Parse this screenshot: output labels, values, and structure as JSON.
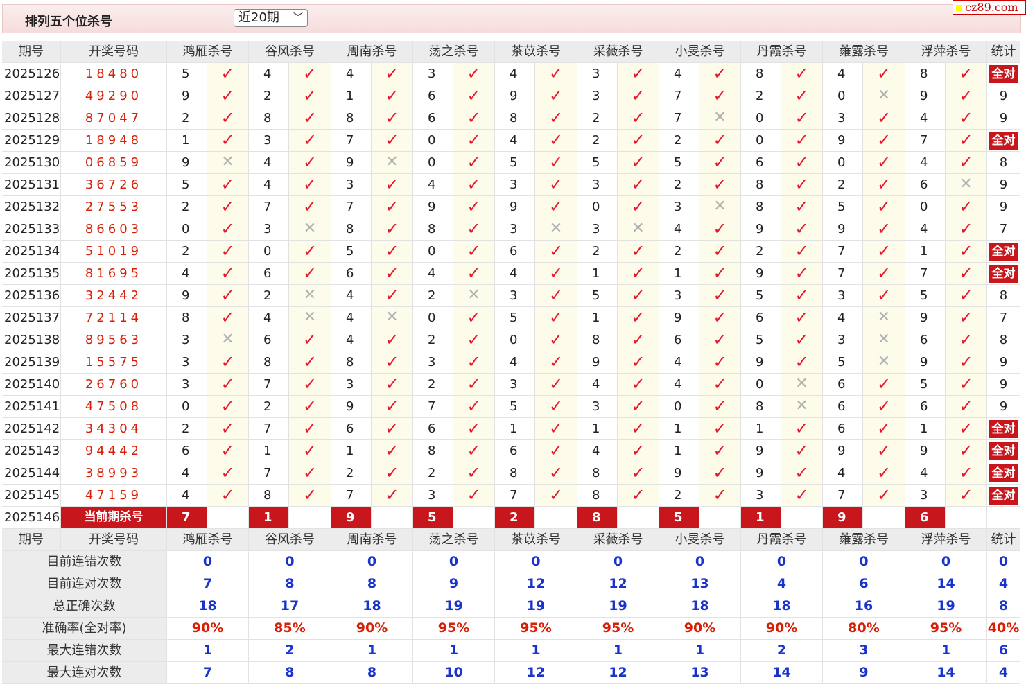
{
  "page_title": "排列五个位杀号",
  "period_select": {
    "value": "近20期"
  },
  "site_badge": "cz89.com",
  "columns": {
    "period": "期号",
    "draw": "开奖号码",
    "experts": [
      "鸿雁杀号",
      "谷风杀号",
      "周南杀号",
      "荡之杀号",
      "茶苡杀号",
      "采薇杀号",
      "小旻杀号",
      "丹霞杀号",
      "蕹露杀号",
      "浮萍杀号"
    ],
    "stat": "统计"
  },
  "rows": [
    {
      "period": "2025126",
      "draw": "18480",
      "kills": [
        5,
        4,
        4,
        3,
        4,
        3,
        4,
        8,
        4,
        8
      ],
      "results": [
        1,
        1,
        1,
        1,
        1,
        1,
        1,
        1,
        1,
        1
      ],
      "stat": "全对"
    },
    {
      "period": "2025127",
      "draw": "49290",
      "kills": [
        9,
        2,
        1,
        6,
        9,
        3,
        7,
        2,
        0,
        9
      ],
      "results": [
        1,
        1,
        1,
        1,
        1,
        1,
        1,
        1,
        0,
        1
      ],
      "stat": "9"
    },
    {
      "period": "2025128",
      "draw": "87047",
      "kills": [
        2,
        8,
        8,
        6,
        8,
        2,
        7,
        0,
        3,
        4
      ],
      "results": [
        1,
        1,
        1,
        1,
        1,
        1,
        0,
        1,
        1,
        1
      ],
      "stat": "9"
    },
    {
      "period": "2025129",
      "draw": "18948",
      "kills": [
        1,
        3,
        7,
        0,
        4,
        2,
        2,
        0,
        9,
        7
      ],
      "results": [
        1,
        1,
        1,
        1,
        1,
        1,
        1,
        1,
        1,
        1
      ],
      "stat": "全对"
    },
    {
      "period": "2025130",
      "draw": "06859",
      "kills": [
        9,
        4,
        9,
        0,
        5,
        5,
        5,
        6,
        0,
        4
      ],
      "results": [
        0,
        1,
        0,
        1,
        1,
        1,
        1,
        1,
        1,
        1
      ],
      "stat": "8"
    },
    {
      "period": "2025131",
      "draw": "36726",
      "kills": [
        5,
        4,
        3,
        4,
        3,
        3,
        2,
        8,
        2,
        6
      ],
      "results": [
        1,
        1,
        1,
        1,
        1,
        1,
        1,
        1,
        1,
        0
      ],
      "stat": "9"
    },
    {
      "period": "2025132",
      "draw": "27553",
      "kills": [
        2,
        7,
        7,
        9,
        9,
        0,
        3,
        8,
        5,
        0
      ],
      "results": [
        1,
        1,
        1,
        1,
        1,
        1,
        0,
        1,
        1,
        1
      ],
      "stat": "9"
    },
    {
      "period": "2025133",
      "draw": "86603",
      "kills": [
        0,
        3,
        8,
        8,
        3,
        3,
        4,
        9,
        9,
        4
      ],
      "results": [
        1,
        0,
        1,
        1,
        0,
        0,
        1,
        1,
        1,
        1
      ],
      "stat": "7"
    },
    {
      "period": "2025134",
      "draw": "51019",
      "kills": [
        2,
        0,
        5,
        0,
        6,
        2,
        2,
        2,
        7,
        1
      ],
      "results": [
        1,
        1,
        1,
        1,
        1,
        1,
        1,
        1,
        1,
        1
      ],
      "stat": "全对"
    },
    {
      "period": "2025135",
      "draw": "81695",
      "kills": [
        4,
        6,
        6,
        4,
        4,
        1,
        1,
        9,
        7,
        7
      ],
      "results": [
        1,
        1,
        1,
        1,
        1,
        1,
        1,
        1,
        1,
        1
      ],
      "stat": "全对"
    },
    {
      "period": "2025136",
      "draw": "32442",
      "kills": [
        9,
        2,
        4,
        2,
        3,
        5,
        3,
        5,
        3,
        5
      ],
      "results": [
        1,
        0,
        1,
        0,
        1,
        1,
        1,
        1,
        1,
        1
      ],
      "stat": "8"
    },
    {
      "period": "2025137",
      "draw": "72114",
      "kills": [
        8,
        4,
        4,
        0,
        5,
        1,
        9,
        6,
        4,
        9
      ],
      "results": [
        1,
        0,
        0,
        1,
        1,
        1,
        1,
        1,
        0,
        1
      ],
      "stat": "7"
    },
    {
      "period": "2025138",
      "draw": "89563",
      "kills": [
        3,
        6,
        4,
        2,
        0,
        8,
        6,
        5,
        3,
        6
      ],
      "results": [
        0,
        1,
        1,
        1,
        1,
        1,
        1,
        1,
        0,
        1
      ],
      "stat": "8"
    },
    {
      "period": "2025139",
      "draw": "15575",
      "kills": [
        3,
        8,
        8,
        3,
        4,
        9,
        4,
        9,
        5,
        9
      ],
      "results": [
        1,
        1,
        1,
        1,
        1,
        1,
        1,
        1,
        0,
        1
      ],
      "stat": "9"
    },
    {
      "period": "2025140",
      "draw": "26760",
      "kills": [
        3,
        7,
        3,
        2,
        3,
        4,
        4,
        0,
        6,
        5
      ],
      "results": [
        1,
        1,
        1,
        1,
        1,
        1,
        1,
        0,
        1,
        1
      ],
      "stat": "9"
    },
    {
      "period": "2025141",
      "draw": "47508",
      "kills": [
        0,
        2,
        9,
        7,
        5,
        3,
        0,
        8,
        6,
        6
      ],
      "results": [
        1,
        1,
        1,
        1,
        1,
        1,
        1,
        0,
        1,
        1
      ],
      "stat": "9"
    },
    {
      "period": "2025142",
      "draw": "34304",
      "kills": [
        2,
        7,
        6,
        6,
        1,
        1,
        1,
        1,
        6,
        1
      ],
      "results": [
        1,
        1,
        1,
        1,
        1,
        1,
        1,
        1,
        1,
        1
      ],
      "stat": "全对"
    },
    {
      "period": "2025143",
      "draw": "94442",
      "kills": [
        6,
        1,
        1,
        8,
        6,
        4,
        1,
        9,
        9,
        9
      ],
      "results": [
        1,
        1,
        1,
        1,
        1,
        1,
        1,
        1,
        1,
        1
      ],
      "stat": "全对"
    },
    {
      "period": "2025144",
      "draw": "38993",
      "kills": [
        4,
        7,
        2,
        2,
        8,
        8,
        9,
        9,
        4,
        4
      ],
      "results": [
        1,
        1,
        1,
        1,
        1,
        1,
        1,
        1,
        1,
        1
      ],
      "stat": "全对"
    },
    {
      "period": "2025145",
      "draw": "47159",
      "kills": [
        4,
        8,
        7,
        3,
        7,
        8,
        2,
        3,
        7,
        3
      ],
      "results": [
        1,
        1,
        1,
        1,
        1,
        1,
        1,
        1,
        1,
        1
      ],
      "stat": "全对"
    }
  ],
  "current": {
    "period": "2025146",
    "label": "当前期杀号",
    "kills": [
      7,
      1,
      9,
      5,
      2,
      8,
      5,
      1,
      9,
      6
    ]
  },
  "summary": [
    {
      "label": "目前连错次数",
      "values": [
        "0",
        "0",
        "0",
        "0",
        "0",
        "0",
        "0",
        "0",
        "0",
        "0",
        "0"
      ],
      "kind": "num"
    },
    {
      "label": "目前连对次数",
      "values": [
        "7",
        "8",
        "8",
        "9",
        "12",
        "12",
        "13",
        "4",
        "6",
        "14",
        "4"
      ],
      "kind": "num"
    },
    {
      "label": "总正确次数",
      "values": [
        "18",
        "17",
        "18",
        "19",
        "19",
        "19",
        "18",
        "18",
        "16",
        "19",
        "8"
      ],
      "kind": "num"
    },
    {
      "label": "准确率(全对率)",
      "values": [
        "90%",
        "85%",
        "90%",
        "95%",
        "95%",
        "95%",
        "90%",
        "90%",
        "80%",
        "95%",
        "40%"
      ],
      "kind": "pct"
    },
    {
      "label": "最大连错次数",
      "values": [
        "1",
        "2",
        "1",
        "1",
        "1",
        "1",
        "1",
        "2",
        "3",
        "1",
        "6"
      ],
      "kind": "num"
    },
    {
      "label": "最大连对次数",
      "values": [
        "7",
        "8",
        "8",
        "10",
        "12",
        "12",
        "13",
        "14",
        "9",
        "14",
        "4"
      ],
      "kind": "num"
    }
  ],
  "marks": {
    "hit": "✓",
    "miss": "✕"
  }
}
